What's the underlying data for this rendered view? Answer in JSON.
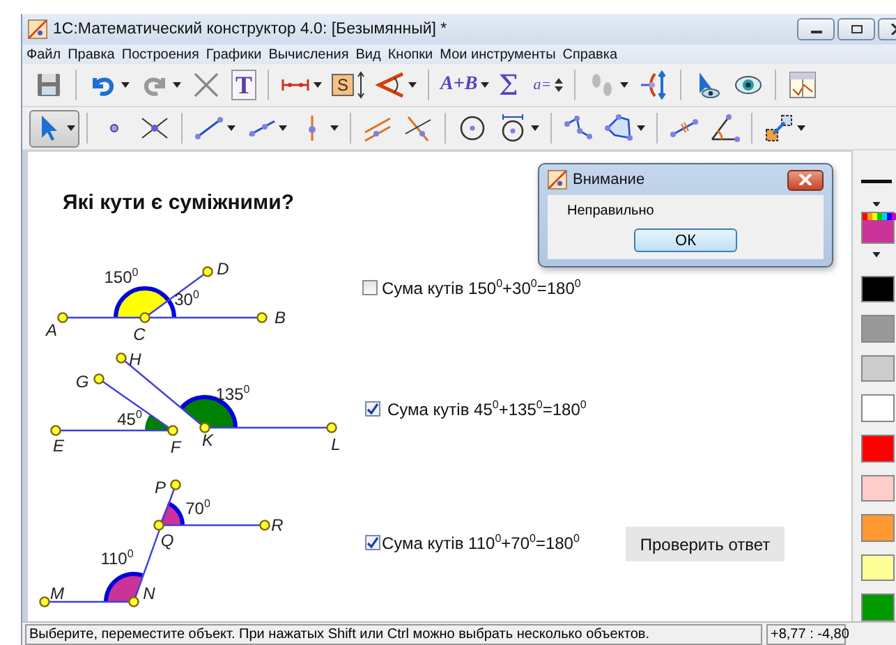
{
  "window": {
    "title": "1С:Математический конструктор 4.0: [Безымянный] *"
  },
  "menu": [
    "Файл",
    "Правка",
    "Построения",
    "Графики",
    "Вычисления",
    "Вид",
    "Кнопки",
    "Мои инструменты",
    "Справка"
  ],
  "toolbars": [
    [
      [
        {
          "kind": "save",
          "dropdown": false,
          "selected": false
        }
      ],
      [
        {
          "kind": "undo",
          "dropdown": true,
          "selected": false
        },
        {
          "kind": "redo",
          "dropdown": true,
          "selected": false
        },
        {
          "kind": "delete",
          "dropdown": false,
          "selected": false
        },
        {
          "kind": "text",
          "label": "T",
          "dropdown": false,
          "selected": false
        }
      ],
      [
        {
          "kind": "measure",
          "dropdown": true,
          "selected": false
        },
        {
          "kind": "area",
          "label": "S",
          "dropdown": false,
          "selected": false
        },
        {
          "kind": "angle-measure",
          "dropdown": true,
          "selected": false
        }
      ],
      [
        {
          "kind": "formula",
          "label": "A+B",
          "dropdown": true,
          "selected": false
        },
        {
          "kind": "sum",
          "label": "Σ",
          "dropdown": false,
          "selected": false
        },
        {
          "kind": "param",
          "label": "a=",
          "dropdown": false,
          "selected": false
        }
      ],
      [
        {
          "kind": "trace",
          "dropdown": true,
          "selected": false
        },
        {
          "kind": "locus",
          "dropdown": false,
          "selected": false
        }
      ],
      [
        {
          "kind": "cursor-eye",
          "dropdown": false,
          "selected": false
        },
        {
          "kind": "eye",
          "dropdown": false,
          "selected": false
        }
      ],
      [
        {
          "kind": "table",
          "dropdown": false,
          "selected": false
        }
      ]
    ],
    [
      [
        {
          "kind": "arrow",
          "dropdown": true,
          "selected": true
        }
      ],
      [
        {
          "kind": "point",
          "dropdown": false,
          "selected": false
        },
        {
          "kind": "intersection",
          "dropdown": false,
          "selected": false
        }
      ],
      [
        {
          "kind": "segment",
          "dropdown": true,
          "selected": false
        },
        {
          "kind": "ray",
          "dropdown": true,
          "selected": false
        },
        {
          "kind": "perpendicular",
          "dropdown": true,
          "selected": false
        }
      ],
      [
        {
          "kind": "parallel",
          "dropdown": false,
          "selected": false
        },
        {
          "kind": "cross-lines",
          "dropdown": false,
          "selected": false
        }
      ],
      [
        {
          "kind": "circle",
          "dropdown": false,
          "selected": false
        },
        {
          "kind": "circle-radius",
          "dropdown": true,
          "selected": false
        }
      ],
      [
        {
          "kind": "polyline",
          "dropdown": false,
          "selected": false
        },
        {
          "kind": "polygon",
          "dropdown": true,
          "selected": false
        }
      ],
      [
        {
          "kind": "midpoint",
          "dropdown": false,
          "selected": false
        },
        {
          "kind": "angle",
          "dropdown": false,
          "selected": false
        }
      ],
      [
        {
          "kind": "transform",
          "dropdown": true,
          "selected": false
        }
      ]
    ]
  ],
  "question": "Які кути є суміжними?",
  "figures": [
    {
      "color": "#ffff00",
      "points": [
        "A",
        "B",
        "C",
        "D"
      ],
      "angle_labels": [
        "150$^{0}$",
        "30$^{0}$"
      ]
    },
    {
      "color": "#008000",
      "points": [
        "E",
        "F",
        "G",
        "H",
        "K",
        "L"
      ],
      "angle_labels": [
        "45$^{0}$",
        "135$^{0}$"
      ]
    },
    {
      "color": "#cc3399",
      "points": [
        "P",
        "Q",
        "R",
        "M",
        "N"
      ],
      "angle_labels": [
        "70$^{0}$",
        "110$^{0}$"
      ]
    }
  ],
  "answers": [
    {
      "label": "Сума кутів 150$^{0}$+30$^{0}$=180$^{0}$",
      "checked": false
    },
    {
      "label": "Сума кутів 45$^{0}$+135$^{0}$=180$^{0}$",
      "checked": true
    },
    {
      "label": "Сума кутів 110$^{0}$+70$^{0}$=180$^{0}$",
      "checked": true
    }
  ],
  "check_button": "Проверить ответ",
  "dialog": {
    "title": "Внимание",
    "message": "Неправильно",
    "button": "ОК"
  },
  "palette": {
    "current": {
      "color": "#cc3399"
    },
    "colors": [
      {
        "color": "#000000"
      },
      {
        "color": "#999999"
      },
      {
        "color": "#cccccc"
      },
      {
        "color": "#ffffff"
      },
      {
        "color": "#ff0000"
      },
      {
        "color": "#ffcccc"
      },
      {
        "color": "#ff9933"
      },
      {
        "color": "#ffff99"
      },
      {
        "color": "#009900"
      }
    ]
  },
  "status_bar": {
    "message": "Выберите, переместите объект. При нажатых Shift или Ctrl можно выбрать несколько объектов.",
    "coordinates": "+8,77 : -4,80"
  }
}
